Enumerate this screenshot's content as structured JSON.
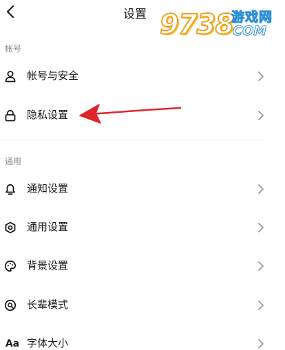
{
  "header": {
    "title": "设置",
    "back_icon": "chevron-left-icon"
  },
  "watermark": {
    "digits": "9738",
    "top_text": "游戏网",
    "bottom_text": "COM"
  },
  "sections": [
    {
      "label": "帐号",
      "items": [
        {
          "label": "帐号与安全",
          "icon": "user-icon"
        },
        {
          "label": "隐私设置",
          "icon": "lock-icon"
        }
      ]
    },
    {
      "label": "通用",
      "items": [
        {
          "label": "通知设置",
          "icon": "bell-icon"
        },
        {
          "label": "通用设置",
          "icon": "gear-icon"
        },
        {
          "label": "背景设置",
          "icon": "palette-icon"
        },
        {
          "label": "长辈模式",
          "icon": "elder-mode-icon"
        },
        {
          "label": "字体大小",
          "icon": "font-size-icon",
          "icon_text": "Aa"
        }
      ]
    }
  ],
  "colors": {
    "annotation_arrow": "#e0242b",
    "section_label": "#8a8a8a",
    "chevron": "#9a9a9a"
  }
}
